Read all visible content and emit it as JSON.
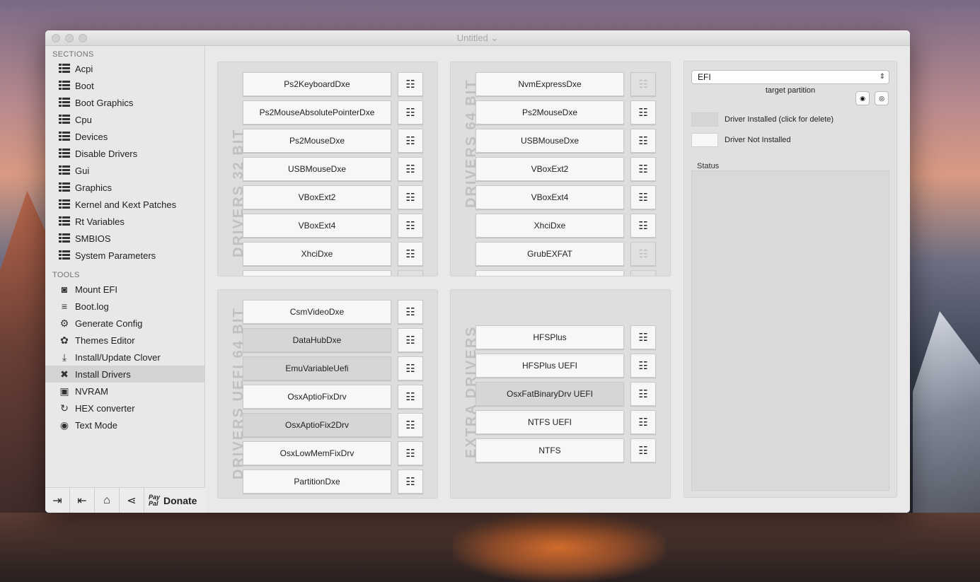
{
  "window": {
    "title": "Untitled ⌄"
  },
  "sidebar": {
    "sections_header": "SECTIONS",
    "sections": [
      {
        "label": "Acpi"
      },
      {
        "label": "Boot"
      },
      {
        "label": "Boot Graphics"
      },
      {
        "label": "Cpu"
      },
      {
        "label": "Devices"
      },
      {
        "label": "Disable Drivers"
      },
      {
        "label": "Gui"
      },
      {
        "label": "Graphics"
      },
      {
        "label": "Kernel and Kext Patches"
      },
      {
        "label": "Rt Variables"
      },
      {
        "label": "SMBIOS"
      },
      {
        "label": "System Parameters"
      }
    ],
    "tools_header": "TOOLS",
    "tools": [
      {
        "label": "Mount EFI",
        "icon": "disk-icon",
        "glyph": "◙"
      },
      {
        "label": "Boot.log",
        "icon": "log-icon",
        "glyph": "≡"
      },
      {
        "label": "Generate Config",
        "icon": "gears-icon",
        "glyph": "⚙"
      },
      {
        "label": "Themes Editor",
        "icon": "palette-icon",
        "glyph": "✿"
      },
      {
        "label": "Install/Update Clover",
        "icon": "download-icon",
        "glyph": "⤓"
      },
      {
        "label": "Install Drivers",
        "icon": "tools-icon",
        "glyph": "✖"
      },
      {
        "label": "NVRAM",
        "icon": "chip-icon",
        "glyph": "▣"
      },
      {
        "label": "HEX converter",
        "icon": "refresh-icon",
        "glyph": "↻"
      },
      {
        "label": "Text Mode",
        "icon": "eye-icon",
        "glyph": "◉"
      }
    ],
    "selected_tool": "Install Drivers",
    "bottom": {
      "donate": "Donate",
      "paypal_top": "Pay",
      "paypal_bottom": "Pal"
    }
  },
  "groups": {
    "drivers32": {
      "label": "DRIVERS 32 BIT",
      "drivers": [
        {
          "name": "Ps2KeyboardDxe",
          "installed": false,
          "doc": true
        },
        {
          "name": "Ps2MouseAbsolutePointerDxe",
          "installed": false,
          "doc": true
        },
        {
          "name": "Ps2MouseDxe",
          "installed": false,
          "doc": true
        },
        {
          "name": "USBMouseDxe",
          "installed": false,
          "doc": true
        },
        {
          "name": "VBoxExt2",
          "installed": false,
          "doc": true
        },
        {
          "name": "VBoxExt4",
          "installed": false,
          "doc": true
        },
        {
          "name": "XhciDxe",
          "installed": false,
          "doc": true
        }
      ]
    },
    "drivers64": {
      "label": "DRIVERS 64 BIT",
      "drivers": [
        {
          "name": "NvmExpressDxe",
          "installed": false,
          "doc": false
        },
        {
          "name": "Ps2MouseDxe",
          "installed": false,
          "doc": true
        },
        {
          "name": "USBMouseDxe",
          "installed": false,
          "doc": true
        },
        {
          "name": "VBoxExt2",
          "installed": false,
          "doc": true
        },
        {
          "name": "VBoxExt4",
          "installed": false,
          "doc": true
        },
        {
          "name": "XhciDxe",
          "installed": false,
          "doc": true
        },
        {
          "name": "GrubEXFAT",
          "installed": false,
          "doc": false
        }
      ]
    },
    "uefi64": {
      "label": "DRIVERS UEFI 64 BIT",
      "drivers": [
        {
          "name": "CsmVideoDxe",
          "installed": false,
          "doc": true
        },
        {
          "name": "DataHubDxe",
          "installed": true,
          "doc": true
        },
        {
          "name": "EmuVariableUefi",
          "installed": true,
          "doc": true
        },
        {
          "name": "OsxAptioFixDrv",
          "installed": false,
          "doc": true
        },
        {
          "name": "OsxAptioFix2Drv",
          "installed": true,
          "doc": true
        },
        {
          "name": "OsxLowMemFixDrv",
          "installed": false,
          "doc": true
        },
        {
          "name": "PartitionDxe",
          "installed": false,
          "doc": true
        }
      ]
    },
    "extra": {
      "label": "EXTRA DRIVERS",
      "drivers": [
        {
          "name": "HFSPlus",
          "installed": false,
          "doc": true
        },
        {
          "name": "HFSPlus UEFI",
          "installed": false,
          "doc": true
        },
        {
          "name": "OsxFatBinaryDrv UEFI",
          "installed": true,
          "doc": true
        },
        {
          "name": "NTFS UEFI",
          "installed": false,
          "doc": true
        },
        {
          "name": "NTFS",
          "installed": false,
          "doc": true
        }
      ]
    }
  },
  "right": {
    "partition_value": "EFI",
    "target_label": "target partition",
    "legend_installed": "Driver Installed (click for delete)",
    "legend_not_installed": "Driver Not Installed",
    "status_label": "Status"
  }
}
